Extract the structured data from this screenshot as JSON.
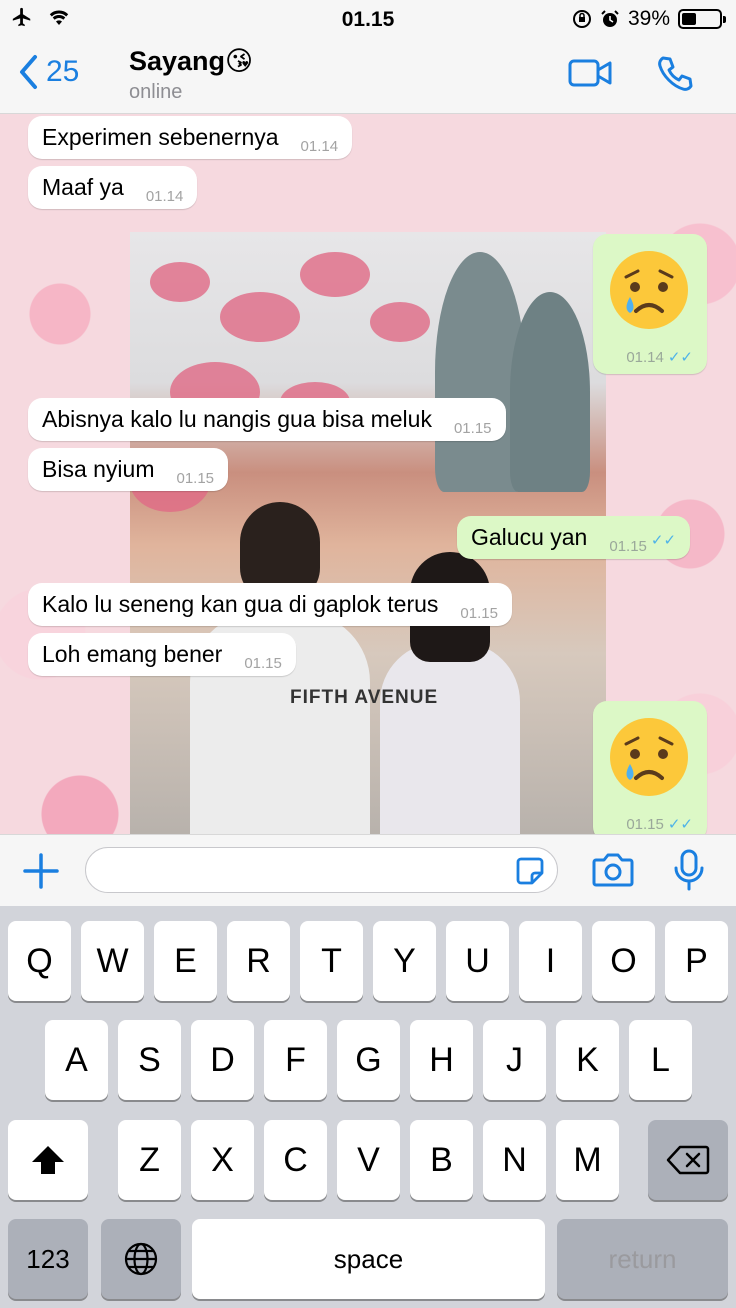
{
  "status_bar": {
    "time": "01.15",
    "battery_percent": "39%",
    "battery_level": 0.39
  },
  "header": {
    "back_count": "25",
    "contact_name": "Sayang😘",
    "contact_status": "online"
  },
  "messages": [
    {
      "text": "Experimen sebenernya",
      "time": "01.14",
      "direction": "in"
    },
    {
      "text": "Maaf ya",
      "time": "01.14",
      "direction": "in"
    },
    {
      "emoji": "crying-face",
      "time": "01.14",
      "direction": "out",
      "read": true
    },
    {
      "text": "Abisnya kalo lu nangis gua bisa meluk",
      "time": "01.15",
      "direction": "in"
    },
    {
      "text": "Bisa nyium",
      "time": "01.15",
      "direction": "in"
    },
    {
      "text": "Galucu yan",
      "time": "01.15",
      "direction": "out",
      "read": true
    },
    {
      "text": "Kalo lu seneng kan gua di gaplok terus",
      "time": "01.15",
      "direction": "in"
    },
    {
      "text": "Loh emang bener",
      "time": "01.15",
      "direction": "in"
    },
    {
      "emoji": "crying-face",
      "time": "01.15",
      "direction": "out",
      "read": true
    }
  ],
  "photo_shirt_text": "FIFTH AVENUE",
  "keyboard": {
    "row1": [
      "Q",
      "W",
      "E",
      "R",
      "T",
      "Y",
      "U",
      "I",
      "O",
      "P"
    ],
    "row2": [
      "A",
      "S",
      "D",
      "F",
      "G",
      "H",
      "J",
      "K",
      "L"
    ],
    "row3": [
      "Z",
      "X",
      "C",
      "V",
      "B",
      "N",
      "M"
    ],
    "numbers_key": "123",
    "space_key": "space",
    "return_key": "return"
  },
  "colors": {
    "accent": "#1a7fe0",
    "outgoing_bubble": "#dcf8c6",
    "incoming_bubble": "#ffffff",
    "read_ticks": "#4fb3e8"
  },
  "icons": [
    "airplane-icon",
    "wifi-icon",
    "lock-rotation-icon",
    "alarm-icon",
    "battery-icon",
    "back-chevron-icon",
    "video-call-icon",
    "phone-icon",
    "plus-icon",
    "sticker-icon",
    "camera-icon",
    "microphone-icon",
    "shift-icon",
    "globe-icon",
    "backspace-icon"
  ]
}
